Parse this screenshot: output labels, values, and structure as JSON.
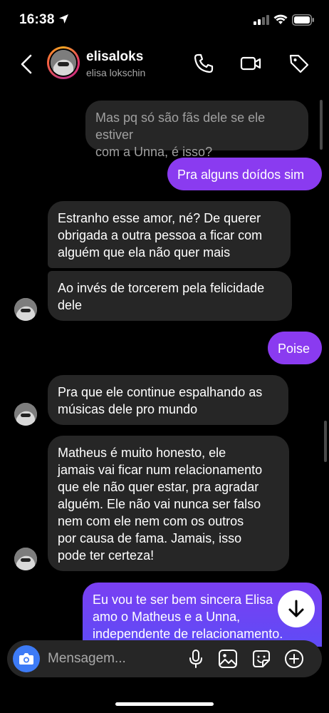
{
  "status_bar": {
    "time": "16:38"
  },
  "header": {
    "username": "elisaloks",
    "full_name": "elisa lokschin"
  },
  "messages": [
    {
      "side": "in",
      "text_lines": [
        "Mas pq só são fãs dele se ele estiver",
        "com a Unna, é isso?"
      ],
      "faded": true
    },
    {
      "side": "out",
      "text_lines": [
        "Pra alguns doídos sim"
      ]
    },
    {
      "side": "in",
      "text_lines": [
        "Estranho esse amor, né? De querer",
        "obrigada a outra pessoa a ficar com",
        "alguém que ela não quer mais"
      ]
    },
    {
      "side": "in",
      "text_lines": [
        "Ao invés de torcerem pela felicidade",
        "dele"
      ]
    },
    {
      "side": "out",
      "text_lines": [
        "Poise"
      ]
    },
    {
      "side": "in",
      "text_lines": [
        "Pra que ele continue espalhando as",
        "músicas dele pro mundo"
      ]
    },
    {
      "side": "in",
      "text_lines": [
        "Matheus é muito honesto, ele",
        "jamais vai ficar num relacionamento",
        "que ele não quer estar, pra agradar",
        "alguém. Ele não vai nunca ser falso",
        "nem com ele nem com os outros",
        "por causa de fama. Jamais, isso",
        "pode ter certeza!"
      ]
    },
    {
      "side": "out",
      "text_lines": [
        "Eu vou te ser bem sincera Elisa",
        "amo o Matheus e a Unna,",
        "independente de relacionamento."
      ]
    }
  ],
  "composer": {
    "placeholder": "Mensagem..."
  },
  "colors": {
    "outgoing": "#8a3bf0",
    "incoming": "#262626",
    "camera": "#3d7bf6"
  }
}
